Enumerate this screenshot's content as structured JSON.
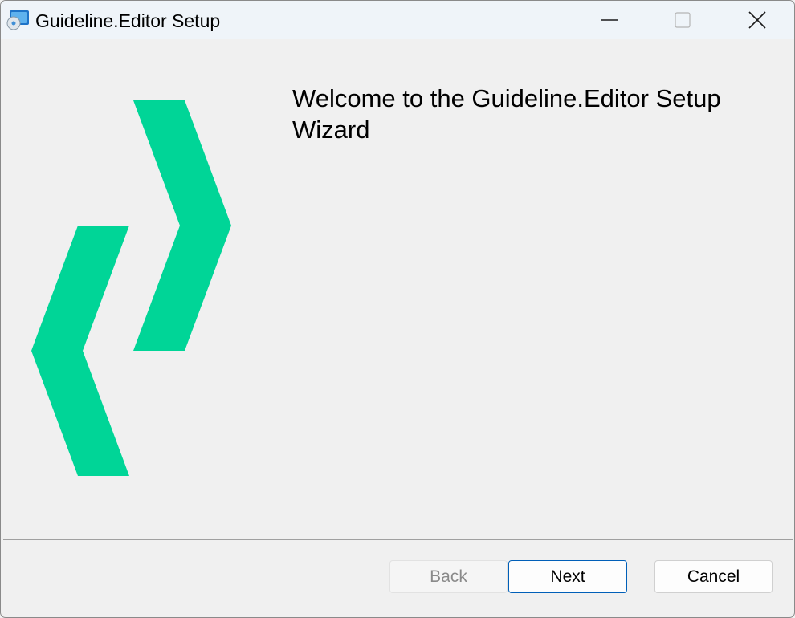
{
  "window": {
    "title": "Guideline.Editor Setup"
  },
  "content": {
    "heading": "Welcome to the Guideline.Editor Setup Wizard"
  },
  "buttons": {
    "back_label": "Back",
    "next_label": "Next",
    "cancel_label": "Cancel"
  },
  "colors": {
    "logo_green": "#00d597",
    "accent_blue": "#005fb8",
    "disabled_text": "#8a8a8a"
  },
  "icons": {
    "app": "installer-disc-icon",
    "logo": "chevrons-logo"
  }
}
